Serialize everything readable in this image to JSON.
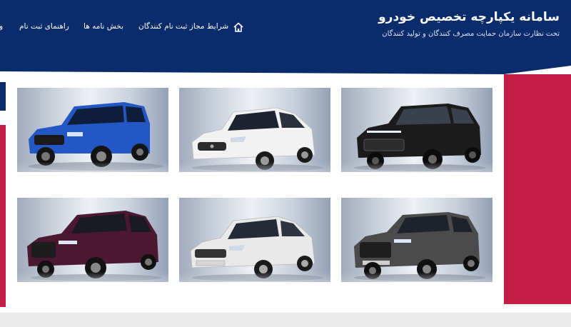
{
  "header": {
    "title": "سامانه یکپارچه تخصیص خودرو",
    "subtitle": "تحت نظارت سازمان حمایت مصرف کنندگان و تولید کنندگان",
    "background_color": "#0b2c6b"
  },
  "nav": {
    "home_icon": "home-icon",
    "items": [
      {
        "label": "شرایط مجاز ثبت نام کنندگان"
      },
      {
        "label": "بخش نامه ها"
      },
      {
        "label": "راهنمای ثبت نام"
      },
      {
        "label": "و"
      }
    ]
  },
  "accent_colors": {
    "red": "#c41d48",
    "navy": "#0b2c6b"
  },
  "cars": [
    {
      "id": "car-1",
      "body_color": "#2357c4"
    },
    {
      "id": "car-2",
      "body_color": "#f2f2f2"
    },
    {
      "id": "car-3",
      "body_color": "#1b1b1b"
    },
    {
      "id": "car-4",
      "body_color": "#4a1830"
    },
    {
      "id": "car-5",
      "body_color": "#e9e9ea"
    },
    {
      "id": "car-6",
      "body_color": "#4b4b4b"
    }
  ]
}
